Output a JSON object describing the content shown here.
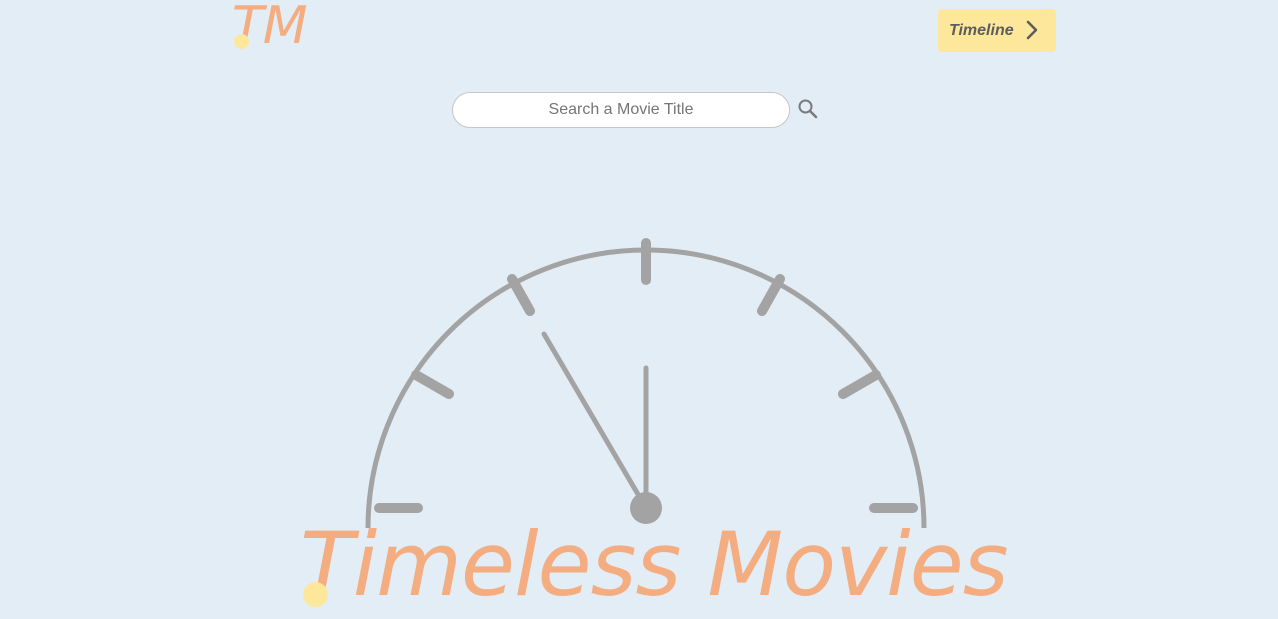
{
  "header": {
    "logo_text": "TM",
    "timeline_label": "Timeline"
  },
  "search": {
    "placeholder": "Search a Movie Title"
  },
  "hero": {
    "title": "Timeless Movies"
  },
  "colors": {
    "background": "#e3edf6",
    "accent_orange": "#f4ad80",
    "accent_yellow": "#fde79a",
    "clock_gray": "#a3a3a3"
  },
  "icons": {
    "timeline_chevron": "chevron-right-icon",
    "search": "search-icon",
    "clock": "clock-icon"
  }
}
